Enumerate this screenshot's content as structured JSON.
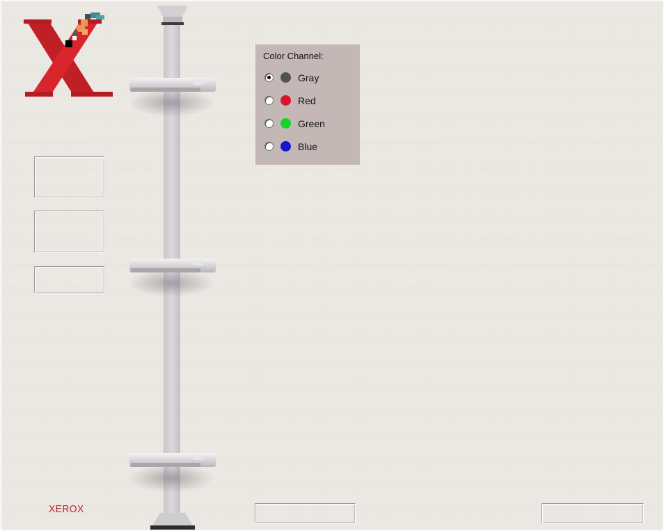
{
  "brand": {
    "wordmark": "XEROX",
    "logo_icon": "xerox-x-logo",
    "brand_color": "#c8202a"
  },
  "nav_buttons": [
    {
      "label": ""
    },
    {
      "label": ""
    },
    {
      "label": ""
    }
  ],
  "color_channel": {
    "title": "Color Channel:",
    "selected": "Gray",
    "options": [
      {
        "label": "Gray",
        "color": "#4f5451",
        "checked": true
      },
      {
        "label": "Red",
        "color": "#d8162b",
        "checked": false
      },
      {
        "label": "Green",
        "color": "#17d424",
        "checked": false
      },
      {
        "label": "Blue",
        "color": "#1616d2",
        "checked": false
      }
    ]
  },
  "bottom_buttons": [
    {
      "label": ""
    },
    {
      "label": ""
    }
  ],
  "colors": {
    "panel_bg": "#c4b8b6",
    "page_bg": "#eeebe6"
  }
}
